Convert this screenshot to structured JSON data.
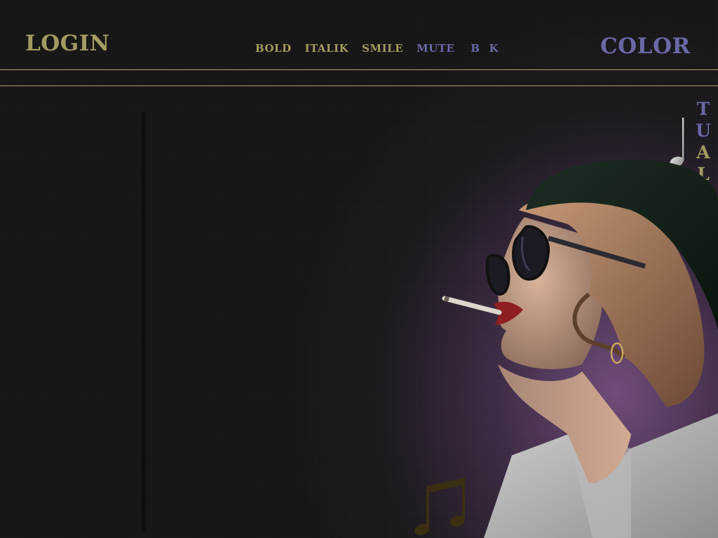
{
  "header": {
    "login_label": "LOGIN",
    "color_label": "COLOR",
    "nav": [
      {
        "label": "BOLD"
      },
      {
        "label": "ITALIK"
      },
      {
        "label": "SMILE"
      },
      {
        "label": "MUTE"
      },
      {
        "label": "B"
      },
      {
        "label": "K"
      }
    ]
  },
  "side_label": {
    "letters": [
      "T",
      "U",
      "A",
      "L"
    ]
  },
  "colors": {
    "olive": "#a39c62",
    "periwinkle": "#6b67a8",
    "rule": "#b49d6a",
    "background": "#131313",
    "purple_glow": "#6e4a78"
  },
  "icons": {
    "single_note": "music-note-icon",
    "double_note": "beamed-notes-icon"
  },
  "illustration": "woman-with-sunglasses-and-cigarette"
}
